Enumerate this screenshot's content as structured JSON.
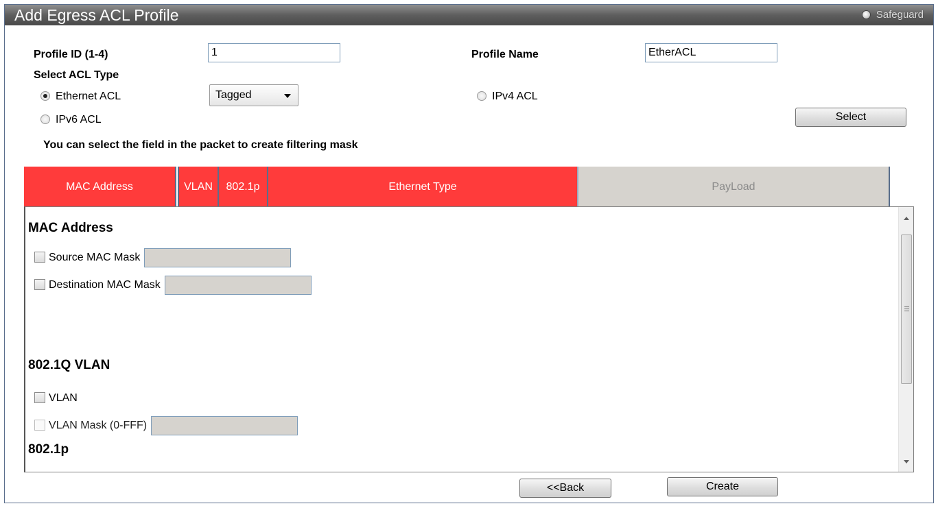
{
  "window": {
    "title": "Add Egress ACL Profile",
    "safeguard_label": "Safeguard"
  },
  "form": {
    "profile_id_label": "Profile ID (1-4)",
    "profile_id_value": "1",
    "profile_name_label": "Profile Name",
    "profile_name_value": "EtherACL",
    "acl_type_label": "Select ACL Type",
    "acl_types": [
      {
        "label": "Ethernet ACL",
        "checked": true
      },
      {
        "label": "IPv4 ACL",
        "checked": false
      },
      {
        "label": "IPv6 ACL",
        "checked": false
      }
    ],
    "tag_select_value": "Tagged",
    "select_button": "Select",
    "hint": "You can select the field in the packet to create filtering mask"
  },
  "packet_fields": [
    {
      "label": "MAC Address",
      "selected": true
    },
    {
      "label": "VLAN",
      "selected": true
    },
    {
      "label": "802.1p",
      "selected": true
    },
    {
      "label": "Ethernet Type",
      "selected": true
    },
    {
      "label": "PayLoad",
      "selected": false
    }
  ],
  "panel": {
    "mac_section_title": "MAC Address",
    "source_mac_label": "Source MAC Mask",
    "dest_mac_label": "Destination MAC Mask",
    "vlan_section_title": "802.1Q VLAN",
    "vlan_label": "VLAN",
    "vlan_mask_label": "VLAN Mask (0-FFF)",
    "dot1p_section_title": "802.1p"
  },
  "buttons": {
    "back": "<<Back",
    "create": "Create"
  },
  "colors": {
    "selected_field": "#ff3b3b",
    "unselected_field": "#d6d3ce",
    "title_bar": "#5e5e5e"
  }
}
